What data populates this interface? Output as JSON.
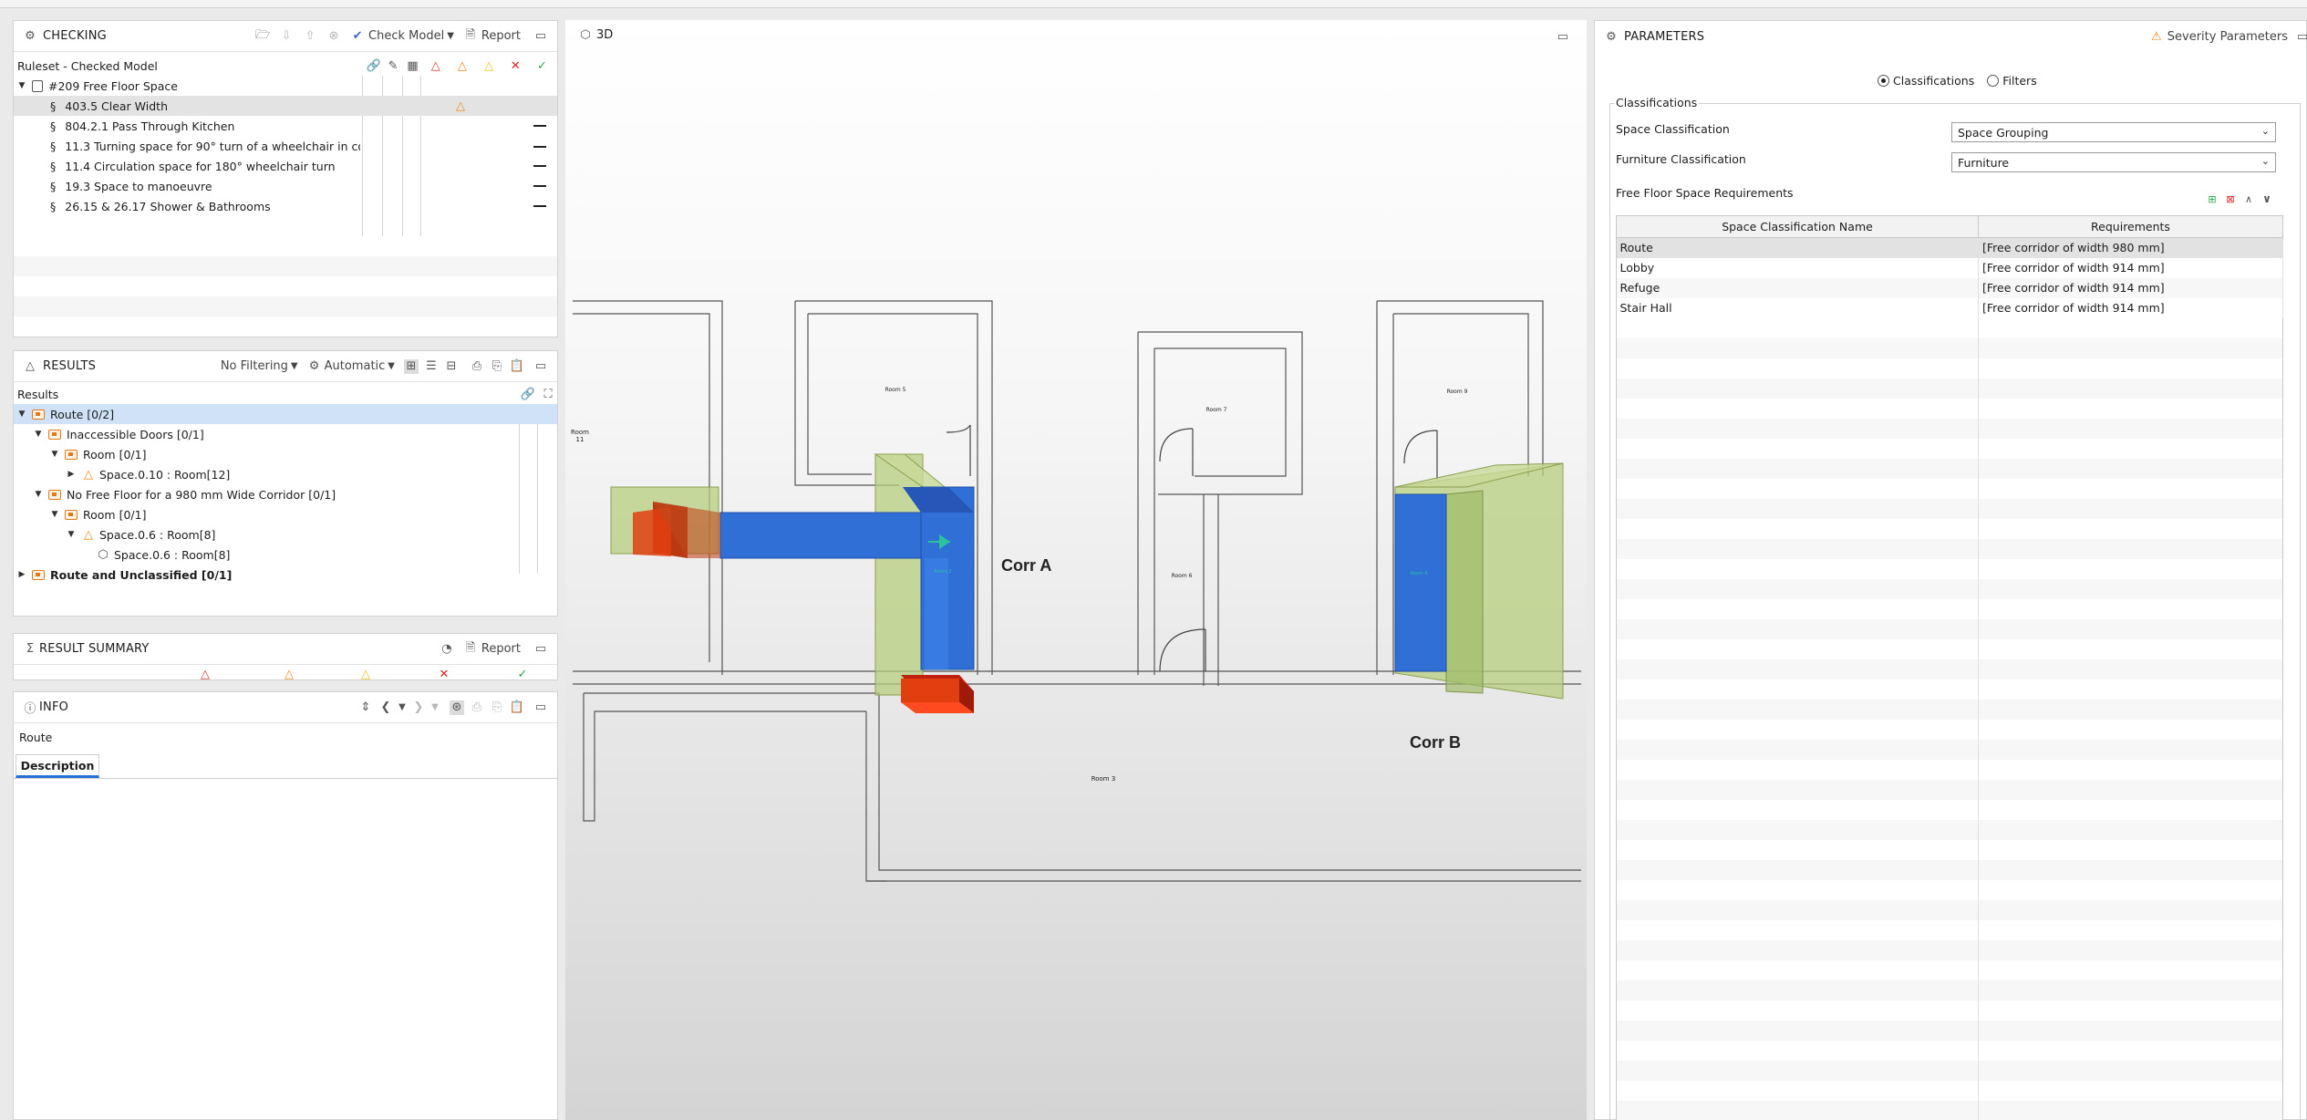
{
  "checking": {
    "title": "CHECKING",
    "check_model": "Check Model",
    "report": "Report",
    "ruleset_label": "Ruleset - Checked Model",
    "root_label": "#209 Free Floor Space",
    "rules": [
      "403.5 Clear Width",
      "804.2.1 Pass Through Kitchen",
      "11.3 Turning space for 90° turn of a wheelchair in corridor",
      "11.4 Circulation space for 180° wheelchair turn",
      "19.3 Space to manoeuvre",
      "26.15 & 26.17 Shower & Bathrooms"
    ]
  },
  "results": {
    "title": "RESULTS",
    "filter": "No Filtering",
    "mode": "Automatic",
    "header": "Results",
    "items": [
      "Route [0/2]",
      "Inaccessible Doors [0/1]",
      "Room [0/1]",
      "Space.0.10 : Room[12]",
      "No Free Floor for a 980 mm Wide Corridor [0/1]",
      "Room [0/1]",
      "Space.0.6 : Room[8]",
      "Space.0.6 : Room[8]",
      "Route and Unclassified [0/1]"
    ]
  },
  "summary": {
    "title": "RESULT SUMMARY",
    "report": "Report"
  },
  "info": {
    "title": "INFO",
    "selected": "Route",
    "tab": "Description"
  },
  "viewport": {
    "title": "3D",
    "corr_a": "Corr A",
    "corr_b": "Corr B",
    "rooms": [
      "Room 5",
      "Room 7",
      "Room 9",
      "Room 6",
      "Room 3",
      "Room 11",
      "Room 2",
      "Room 4"
    ]
  },
  "parameters": {
    "title": "PARAMETERS",
    "severity": "Severity Parameters",
    "radio_classifications": "Classifications",
    "radio_filters": "Filters",
    "group_title": "Classifications",
    "space_classification_label": "Space Classification",
    "space_classification_value": "Space Grouping",
    "furniture_classification_label": "Furniture Classification",
    "furniture_classification_value": "Furniture",
    "requirements_title": "Free Floor Space Requirements",
    "col_name": "Space Classification Name",
    "col_req": "Requirements",
    "rows": [
      {
        "name": "Route",
        "req": "[Free corridor of width 980 mm]"
      },
      {
        "name": "Lobby",
        "req": "[Free corridor of width 914 mm]"
      },
      {
        "name": "Refuge",
        "req": "[Free corridor of width 914 mm]"
      },
      {
        "name": "Stair Hall",
        "req": "[Free corridor of width 914 mm]"
      }
    ]
  },
  "colors": {
    "blue_route": "#2f6fd6",
    "green_space": "#b6cd7c",
    "red_door": "#e23f10",
    "selection": "#cfe2f8"
  }
}
